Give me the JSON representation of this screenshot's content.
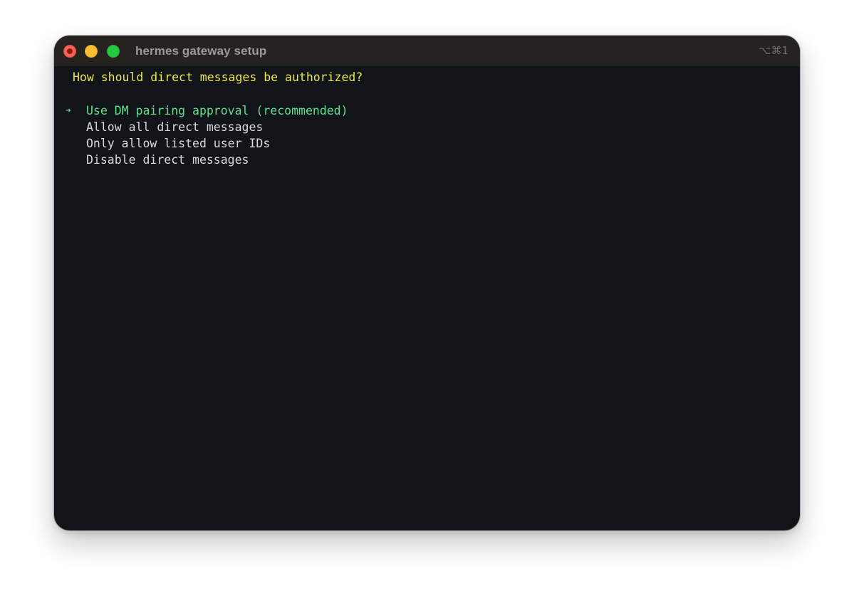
{
  "window": {
    "title": "hermes gateway setup",
    "shortcut": "⌥⌘1"
  },
  "terminal": {
    "prompt": "How should direct messages be authorized?",
    "cursor_glyph": "➔",
    "selected_index": 0,
    "options": [
      {
        "label": "Use DM pairing approval (recommended)"
      },
      {
        "label": "Allow all direct messages"
      },
      {
        "label": "Only allow listed user IDs"
      },
      {
        "label": "Disable direct messages"
      }
    ]
  },
  "colors": {
    "prompt": "#eee54c",
    "selected": "#5fe08a",
    "normal": "#d8dbde",
    "background": "#111418",
    "titlebar": "#252220"
  }
}
